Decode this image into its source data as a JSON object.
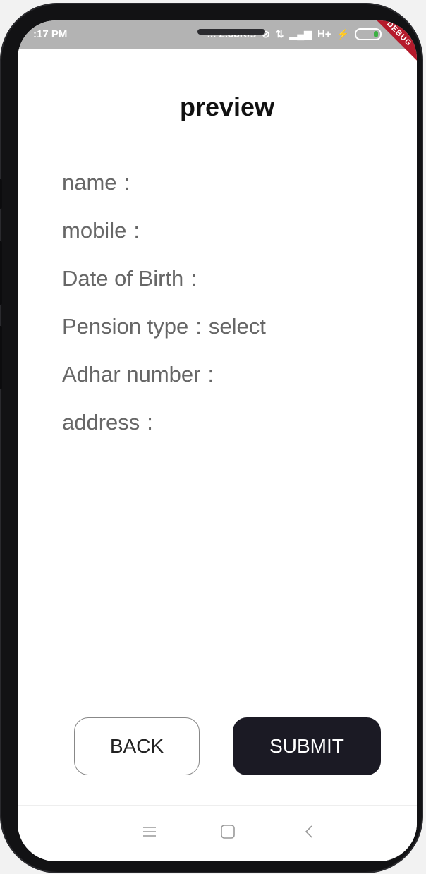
{
  "status_bar": {
    "time": ":17 PM",
    "net_speed": "... 2.33K/s",
    "network": "H+",
    "debug_label": "DEBUG"
  },
  "page": {
    "title": "preview"
  },
  "fields": [
    {
      "label": "name",
      "separator": ":",
      "value": ""
    },
    {
      "label": "mobile",
      "separator": ":",
      "value": ""
    },
    {
      "label": "Date of Birth",
      "separator": ":",
      "value": ""
    },
    {
      "label": "Pension type",
      "separator": ":",
      "value": "select"
    },
    {
      "label": "Adhar number",
      "separator": ":",
      "value": ""
    },
    {
      "label": "address",
      "separator": ":",
      "value": ""
    }
  ],
  "actions": {
    "back_label": "BACK",
    "submit_label": "SUBMIT"
  },
  "nav": {
    "menu_icon": "menu-icon",
    "home_icon": "home-square-icon",
    "back_icon": "back-chevron-icon"
  },
  "colors": {
    "submit_bg": "#1b1a24",
    "status_bar_bg": "#b3b3b3",
    "field_text": "#676767"
  }
}
